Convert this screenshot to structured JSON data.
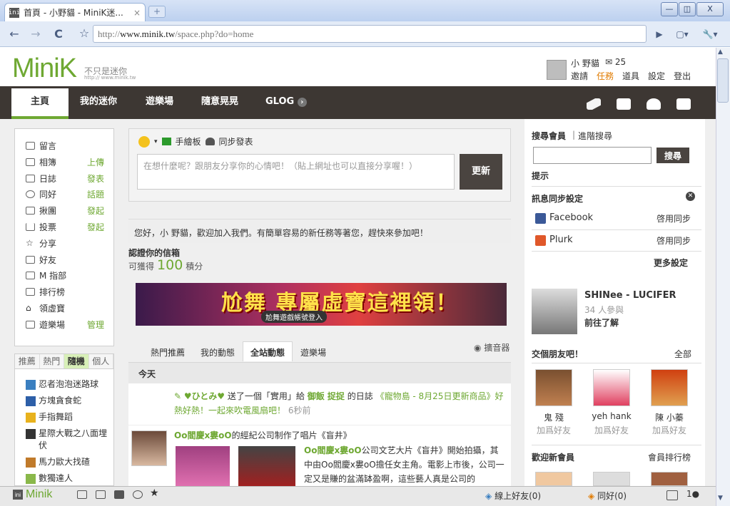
{
  "browser": {
    "tab_title": "首頁 - 小野貓 - MiniK迷...",
    "tab_favicon": "ini",
    "new_tab": "+",
    "url_prefix": "http://",
    "url_host": "www.minik.tw",
    "url_path": "/space.php?do=home",
    "nav_back": "←",
    "nav_forward": "→",
    "reload": "C",
    "bookmark_star": "☆",
    "win_min": "—",
    "win_max": "◫",
    "win_close": "X",
    "play_icon": "▶",
    "page_icon": "▢▾",
    "tools_icon": "🔧▾"
  },
  "site": {
    "logo": "MiniK",
    "tagline": "不只是迷你",
    "tagline_url": "http:// www.minik.tw",
    "user": {
      "name": "小 野貓",
      "mail_icon": "✉",
      "mail_count": "25",
      "links": [
        "邀請",
        "任務",
        "道具",
        "設定",
        "登出"
      ]
    },
    "nav": {
      "items": [
        "主頁",
        "我的迷你",
        "遊樂場",
        "隨意晃晃",
        "GLOG"
      ],
      "glog_arrow": "›"
    }
  },
  "left": {
    "menu": [
      {
        "label": "留言",
        "action": ""
      },
      {
        "label": "相簿",
        "action": "上傳"
      },
      {
        "label": "日誌",
        "action": "發表"
      },
      {
        "label": "同好",
        "action": "話題"
      },
      {
        "label": "揪團",
        "action": "發起"
      },
      {
        "label": "投票",
        "action": "發起"
      },
      {
        "label": "分享",
        "action": ""
      },
      {
        "label": "好友",
        "action": ""
      },
      {
        "label": "M 指部",
        "action": ""
      },
      {
        "label": "排行榜",
        "action": ""
      },
      {
        "label": "領虛寶",
        "action": ""
      },
      {
        "label": "遊樂場",
        "action": "管理"
      }
    ],
    "tabs": [
      "推薦",
      "熱門",
      "隨機",
      "個人"
    ],
    "games": [
      "忍者泡泡迷路球",
      "方塊貪食蛇",
      "手指舞蹈",
      "星際大戰之八面埋伏",
      "馬力歐大找碴",
      "數獨達人"
    ]
  },
  "compose": {
    "tool_draw": "手繪板",
    "tool_sync": "同步發表",
    "placeholder": "在想什麼呢？跟朋友分享你的心情吧！（貼上網址也可以直接分享喔！）",
    "update_button": "更新"
  },
  "welcome": "您好，小 野貓，歡迎加入我們。有簡單容易的新任務等著您，趕快來參加吧！",
  "verify": {
    "title": "認證你的信箱",
    "prefix": "可獲得",
    "points": "100",
    "suffix": "積分"
  },
  "banner": {
    "title": "尬舞 專屬虛寶這裡領！",
    "sub": "尬舞遊戲帳號登入"
  },
  "feed": {
    "tabs": [
      "熱門推薦",
      "我的動態",
      "全站動態",
      "遊樂場"
    ],
    "filter": "擴音器",
    "today": "今天",
    "item1": {
      "user": "♥ひとみ♥",
      "text1": "送了一個「實用」給",
      "target": "御飯 捉捉",
      "text2": "的日誌",
      "link": "《寵物島 - 8月25日更新商品》好熱好熱！一起來吹電風扇吧！",
      "time": "6秒前"
    },
    "item2": {
      "title_user": "Oo閻慶x婁oO",
      "title_text": "的經紀公司制作了唱片《盲井》",
      "body_user": "Oo閻慶x婁oO",
      "body": "公司文艺大片《盲井》開始拍攝，其中由Oo閻慶x婁oO擔任女主角。電影上市後，公司一定又是賺的盆滿缽盈啊，這些藝人真是公司的"
    }
  },
  "right": {
    "search_title": "搜尋會員",
    "search_adv": "進階搜尋",
    "search_button": "搜尋",
    "hint": "提示",
    "sync_title": "訊息同步設定",
    "sync": [
      {
        "name": "Facebook",
        "action": "啓用同步"
      },
      {
        "name": "Plurk",
        "action": "啓用同步"
      }
    ],
    "more_settings": "更多設定",
    "album": {
      "title": "SHINee - LUCIFER",
      "count": "34 人參與",
      "action": "前往了解"
    },
    "friends_title": "交個朋友吧！",
    "friends_all": "全部",
    "friends": [
      {
        "name": "鬼 殘",
        "add": "加爲好友"
      },
      {
        "name": "yeh hank",
        "add": "加爲好友"
      },
      {
        "name": "陳 小蓁",
        "add": "加爲好友"
      }
    ],
    "newmember_title": "歡迎新會員",
    "newmember_rank": "會員排行榜"
  },
  "bottom": {
    "logo": "Minik",
    "online": "線上好友(0)",
    "friends": "同好(0)"
  },
  "colors": {
    "brand_green": "#6ea832",
    "nav_dark": "#3d3733",
    "accent_orange": "#e07b00"
  }
}
